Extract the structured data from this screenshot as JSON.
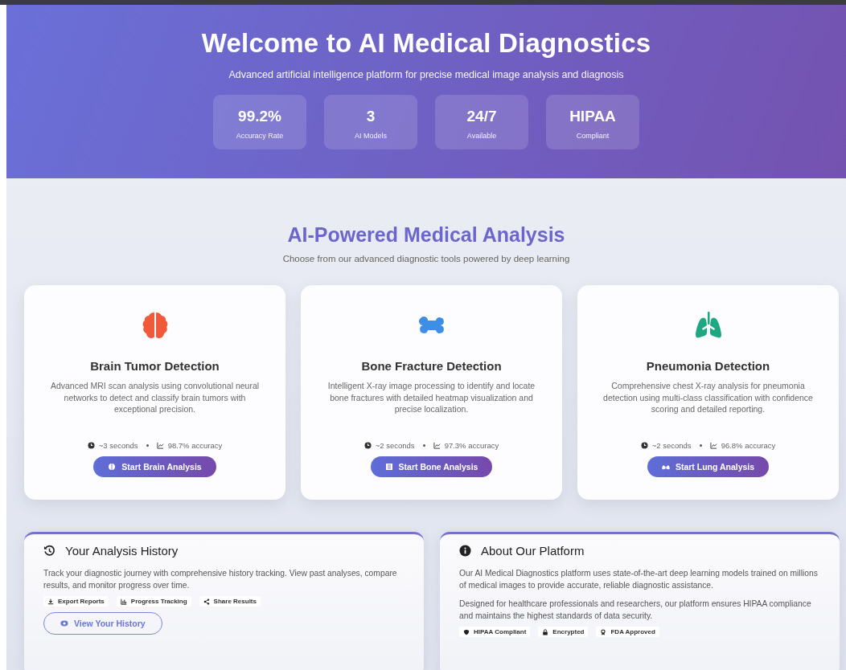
{
  "hero": {
    "title": "Welcome to AI Medical Diagnostics",
    "subtitle": "Advanced artificial intelligence platform for precise medical image analysis and diagnosis",
    "stats": [
      {
        "value": "99.2%",
        "label": "Accuracy Rate"
      },
      {
        "value": "3",
        "label": "AI Models"
      },
      {
        "value": "24/7",
        "label": "Available"
      },
      {
        "value": "HIPAA",
        "label": "Compliant"
      }
    ]
  },
  "section": {
    "title": "AI-Powered Medical Analysis",
    "subtitle": "Choose from our advanced diagnostic tools powered by deep learning"
  },
  "tools": [
    {
      "kind": "brain",
      "title": "Brain Tumor Detection",
      "description": "Advanced MRI scan analysis using convolutional neural networks to detect and classify brain tumors with exceptional precision.",
      "time": "~3 seconds",
      "accuracy": "98.7% accuracy",
      "button": "Start Brain Analysis"
    },
    {
      "kind": "bone",
      "title": "Bone Fracture Detection",
      "description": "Intelligent X-ray image processing to identify and locate bone fractures with detailed heatmap visualization and precise localization.",
      "time": "~2 seconds",
      "accuracy": "97.3% accuracy",
      "button": "Start Bone Analysis"
    },
    {
      "kind": "lungs",
      "title": "Pneumonia Detection",
      "description": "Comprehensive chest X-ray analysis for pneumonia detection using multi-class classification with confidence scoring and detailed reporting.",
      "time": "~2 seconds",
      "accuracy": "96.8% accuracy",
      "button": "Start Lung Analysis"
    }
  ],
  "panels": [
    {
      "kind": "history",
      "title": "Your Analysis History",
      "paragraphs": [
        "Track your diagnostic journey with comprehensive history tracking. View past analyses, compare results, and monitor progress over time."
      ],
      "badges": [
        {
          "kind": "download",
          "label": "Export Reports"
        },
        {
          "kind": "chart",
          "label": "Progress Tracking"
        },
        {
          "kind": "share",
          "label": "Share Results"
        }
      ],
      "button": "View Your History"
    },
    {
      "kind": "info",
      "title": "About Our Platform",
      "paragraphs": [
        "Our AI Medical Diagnostics platform uses state-of-the-art deep learning models trained on millions of medical images to provide accurate, reliable diagnostic assistance.",
        "Designed for healthcare professionals and researchers, our platform ensures HIPAA compliance and maintains the highest standards of data security."
      ],
      "badges": [
        {
          "kind": "shield",
          "label": "HIPAA Compliant"
        },
        {
          "kind": "lock",
          "label": "Encrypted"
        },
        {
          "kind": "award",
          "label": "FDA Approved"
        }
      ]
    }
  ]
}
